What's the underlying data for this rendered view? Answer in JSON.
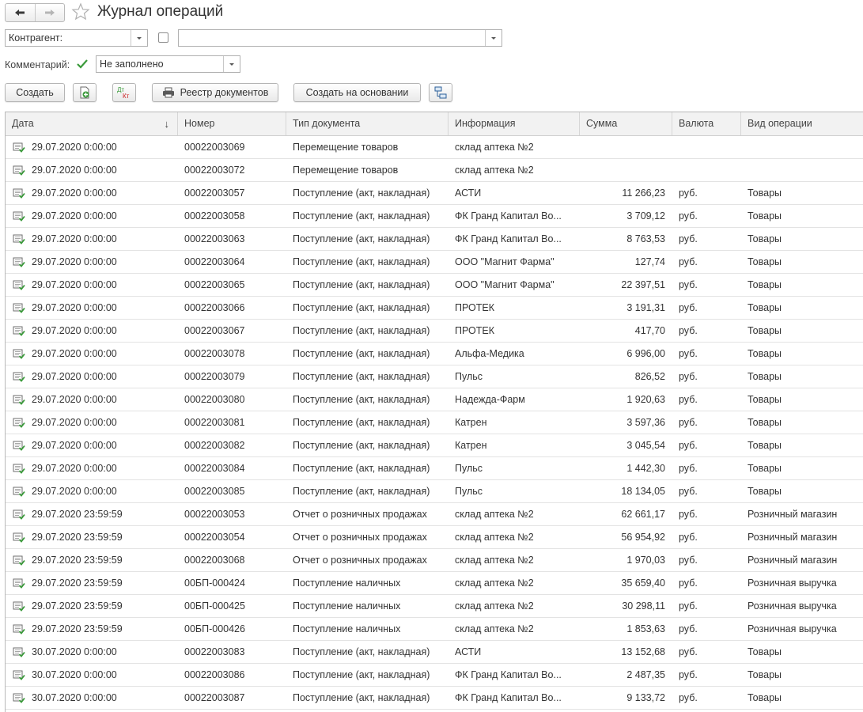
{
  "window": {
    "title": "Журнал операций"
  },
  "filters": {
    "counterparty_label": "Контрагент:",
    "counterparty_value": "",
    "comment_label": "Комментарий:",
    "comment_value": "Не заполнено"
  },
  "toolbar": {
    "create_label": "Создать",
    "registry_label": "Реестр документов",
    "create_based_label": "Создать на основании",
    "dtkt_top": "Дт",
    "dtkt_bottom": "Кт"
  },
  "colors": {
    "accent_green": "#3a9a3a",
    "header_bg": "#f2f2f2",
    "border": "#b8b8b8",
    "dtkt_red": "#cc2222"
  },
  "table": {
    "columns": [
      "Дата",
      "Номер",
      "Тип документа",
      "Информация",
      "Сумма",
      "Валюта",
      "Вид операции"
    ],
    "sort_indicator": "↓",
    "rows": [
      {
        "date": "29.07.2020 0:00:00",
        "number": "00022003069",
        "type": "Перемещение товаров",
        "info": "склад аптека №2",
        "sum": "",
        "currency": "",
        "op": ""
      },
      {
        "date": "29.07.2020 0:00:00",
        "number": "00022003072",
        "type": "Перемещение товаров",
        "info": "склад аптека №2",
        "sum": "",
        "currency": "",
        "op": ""
      },
      {
        "date": "29.07.2020 0:00:00",
        "number": "00022003057",
        "type": "Поступление (акт, накладная)",
        "info": "АСТИ",
        "sum": "11 266,23",
        "currency": "руб.",
        "op": "Товары"
      },
      {
        "date": "29.07.2020 0:00:00",
        "number": "00022003058",
        "type": "Поступление (акт, накладная)",
        "info": "ФК Гранд Капитал Во...",
        "sum": "3 709,12",
        "currency": "руб.",
        "op": "Товары"
      },
      {
        "date": "29.07.2020 0:00:00",
        "number": "00022003063",
        "type": "Поступление (акт, накладная)",
        "info": "ФК Гранд Капитал Во...",
        "sum": "8 763,53",
        "currency": "руб.",
        "op": "Товары"
      },
      {
        "date": "29.07.2020 0:00:00",
        "number": "00022003064",
        "type": "Поступление (акт, накладная)",
        "info": "ООО \"Магнит Фарма\"",
        "sum": "127,74",
        "currency": "руб.",
        "op": "Товары"
      },
      {
        "date": "29.07.2020 0:00:00",
        "number": "00022003065",
        "type": "Поступление (акт, накладная)",
        "info": "ООО \"Магнит Фарма\"",
        "sum": "22 397,51",
        "currency": "руб.",
        "op": "Товары"
      },
      {
        "date": "29.07.2020 0:00:00",
        "number": "00022003066",
        "type": "Поступление (акт, накладная)",
        "info": "ПРОТЕК",
        "sum": "3 191,31",
        "currency": "руб.",
        "op": "Товары"
      },
      {
        "date": "29.07.2020 0:00:00",
        "number": "00022003067",
        "type": "Поступление (акт, накладная)",
        "info": "ПРОТЕК",
        "sum": "417,70",
        "currency": "руб.",
        "op": "Товары"
      },
      {
        "date": "29.07.2020 0:00:00",
        "number": "00022003078",
        "type": "Поступление (акт, накладная)",
        "info": "Альфа-Медика",
        "sum": "6 996,00",
        "currency": "руб.",
        "op": "Товары"
      },
      {
        "date": "29.07.2020 0:00:00",
        "number": "00022003079",
        "type": "Поступление (акт, накладная)",
        "info": "Пульс",
        "sum": "826,52",
        "currency": "руб.",
        "op": "Товары"
      },
      {
        "date": "29.07.2020 0:00:00",
        "number": "00022003080",
        "type": "Поступление (акт, накладная)",
        "info": "Надежда-Фарм",
        "sum": "1 920,63",
        "currency": "руб.",
        "op": "Товары"
      },
      {
        "date": "29.07.2020 0:00:00",
        "number": "00022003081",
        "type": "Поступление (акт, накладная)",
        "info": "Катрен",
        "sum": "3 597,36",
        "currency": "руб.",
        "op": "Товары"
      },
      {
        "date": "29.07.2020 0:00:00",
        "number": "00022003082",
        "type": "Поступление (акт, накладная)",
        "info": "Катрен",
        "sum": "3 045,54",
        "currency": "руб.",
        "op": "Товары"
      },
      {
        "date": "29.07.2020 0:00:00",
        "number": "00022003084",
        "type": "Поступление (акт, накладная)",
        "info": "Пульс",
        "sum": "1 442,30",
        "currency": "руб.",
        "op": "Товары"
      },
      {
        "date": "29.07.2020 0:00:00",
        "number": "00022003085",
        "type": "Поступление (акт, накладная)",
        "info": "Пульс",
        "sum": "18 134,05",
        "currency": "руб.",
        "op": "Товары"
      },
      {
        "date": "29.07.2020 23:59:59",
        "number": "00022003053",
        "type": "Отчет о розничных продажах",
        "info": "склад аптека №2",
        "sum": "62 661,17",
        "currency": "руб.",
        "op": "Розничный магазин"
      },
      {
        "date": "29.07.2020 23:59:59",
        "number": "00022003054",
        "type": "Отчет о розничных продажах",
        "info": "склад аптека №2",
        "sum": "56 954,92",
        "currency": "руб.",
        "op": "Розничный магазин"
      },
      {
        "date": "29.07.2020 23:59:59",
        "number": "00022003068",
        "type": "Отчет о розничных продажах",
        "info": "склад аптека №2",
        "sum": "1 970,03",
        "currency": "руб.",
        "op": "Розничный магазин"
      },
      {
        "date": "29.07.2020 23:59:59",
        "number": "00БП-000424",
        "type": "Поступление наличных",
        "info": "склад аптека №2",
        "sum": "35 659,40",
        "currency": "руб.",
        "op": "Розничная выручка"
      },
      {
        "date": "29.07.2020 23:59:59",
        "number": "00БП-000425",
        "type": "Поступление наличных",
        "info": "склад аптека №2",
        "sum": "30 298,11",
        "currency": "руб.",
        "op": "Розничная выручка"
      },
      {
        "date": "29.07.2020 23:59:59",
        "number": "00БП-000426",
        "type": "Поступление наличных",
        "info": "склад аптека №2",
        "sum": "1 853,63",
        "currency": "руб.",
        "op": "Розничная выручка"
      },
      {
        "date": "30.07.2020 0:00:00",
        "number": "00022003083",
        "type": "Поступление (акт, накладная)",
        "info": "АСТИ",
        "sum": "13 152,68",
        "currency": "руб.",
        "op": "Товары"
      },
      {
        "date": "30.07.2020 0:00:00",
        "number": "00022003086",
        "type": "Поступление (акт, накладная)",
        "info": "ФК Гранд Капитал Во...",
        "sum": "2 487,35",
        "currency": "руб.",
        "op": "Товары"
      },
      {
        "date": "30.07.2020 0:00:00",
        "number": "00022003087",
        "type": "Поступление (акт, накладная)",
        "info": "ФК Гранд Капитал Во...",
        "sum": "9 133,72",
        "currency": "руб.",
        "op": "Товары"
      }
    ]
  }
}
